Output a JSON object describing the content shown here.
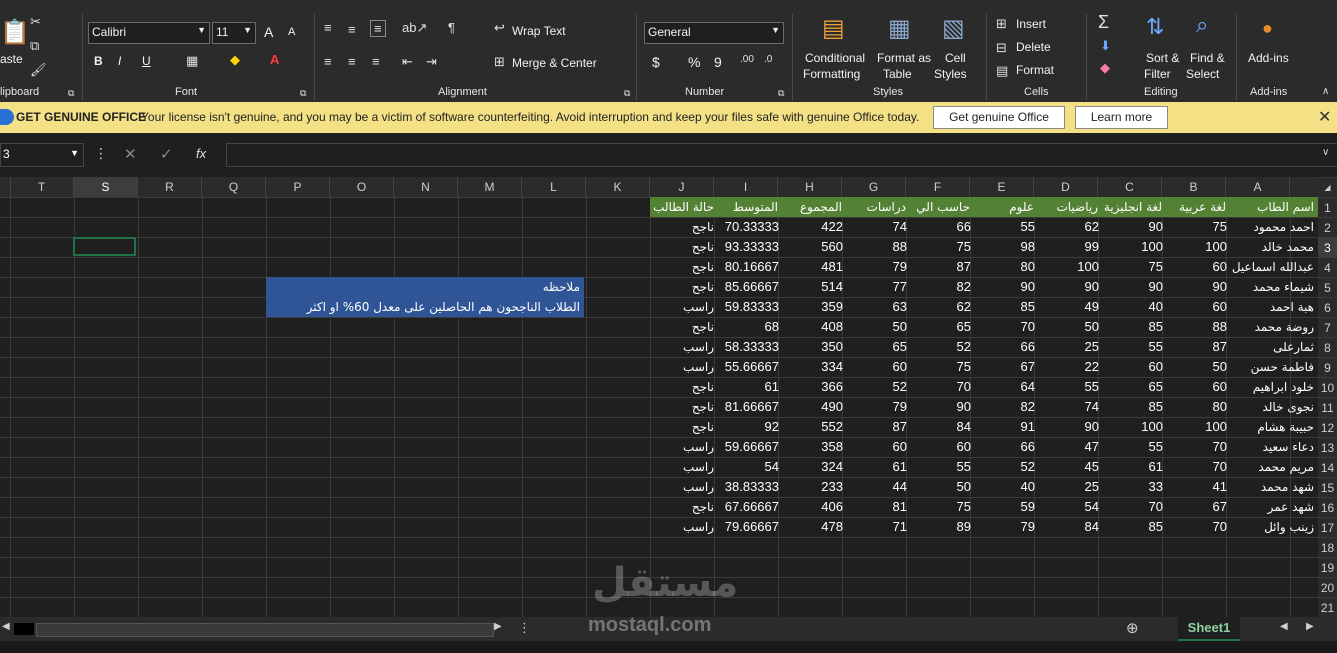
{
  "ribbon": {
    "clipboard": {
      "paste": "aste",
      "label": "lipboard"
    },
    "font": {
      "name": "Calibri",
      "size": "11",
      "label": "Font",
      "bold": "B",
      "italic": "I",
      "underline": "U",
      "grow": "A",
      "shrink": "A"
    },
    "alignment": {
      "wrap": "Wrap Text",
      "merge": "Merge & Center",
      "label": "Alignment"
    },
    "number": {
      "format": "General",
      "label": "Number",
      "currency": "$",
      "percent": "%",
      "comma": "9"
    },
    "styles": {
      "conditional": [
        "Conditional",
        "Formatting"
      ],
      "format_table": [
        "Format as",
        "Table"
      ],
      "cell_styles": [
        "Cell",
        "Styles"
      ],
      "label": "Styles"
    },
    "cells": {
      "insert": "Insert",
      "delete": "Delete",
      "format": "Format",
      "label": "Cells"
    },
    "editing": {
      "sort": [
        "Sort &",
        "Filter"
      ],
      "find": [
        "Find &",
        "Select"
      ],
      "label": "Editing"
    },
    "addins": {
      "button": "Add-ins",
      "label": "Add-ins"
    }
  },
  "banner": {
    "title": "GET GENUINE OFFICE",
    "message": "Your license isn't genuine, and you may be a victim of software counterfeiting. Avoid interruption and keep your files safe with genuine Office today.",
    "btn_genuine": "Get genuine Office",
    "btn_learn": "Learn more"
  },
  "formula_bar": {
    "namebox": "3",
    "fx": "fx",
    "value": ""
  },
  "columns": [
    "T",
    "S",
    "R",
    "Q",
    "P",
    "O",
    "N",
    "M",
    "L",
    "K",
    "J",
    "I",
    "H",
    "G",
    "F",
    "E",
    "D",
    "C",
    "B",
    "A"
  ],
  "rows": [
    "1",
    "2",
    "3",
    "4",
    "5",
    "6",
    "7",
    "8",
    "9",
    "10",
    "11",
    "12",
    "13",
    "14",
    "15",
    "16",
    "17",
    "18",
    "19",
    "20",
    "21"
  ],
  "table": {
    "headers": [
      "اسم الطاب",
      "لغة عربية",
      "لغة انجليزية",
      "رياضيات",
      "علوم",
      "حاسب الي",
      "دراسات",
      "المجموع",
      "المتوسط",
      "حالة الطالب"
    ],
    "rows": [
      [
        "احمد محمود",
        "75",
        "90",
        "62",
        "55",
        "66",
        "74",
        "422",
        "70.33333",
        "ناجح"
      ],
      [
        "محمد خالد",
        "100",
        "100",
        "99",
        "98",
        "75",
        "88",
        "560",
        "93.33333",
        "ناجح"
      ],
      [
        "عبدالله اسماعيل",
        "60",
        "75",
        "100",
        "80",
        "87",
        "79",
        "481",
        "80.16667",
        "ناجح"
      ],
      [
        "شيماء محمد",
        "90",
        "90",
        "90",
        "90",
        "82",
        "77",
        "514",
        "85.66667",
        "ناجح"
      ],
      [
        "هبة احمد",
        "60",
        "40",
        "49",
        "85",
        "62",
        "63",
        "359",
        "59.83333",
        "راسب"
      ],
      [
        "روضة محمد",
        "88",
        "85",
        "50",
        "70",
        "65",
        "50",
        "408",
        "68",
        "ناجح"
      ],
      [
        "ثمارعلى",
        "87",
        "55",
        "25",
        "66",
        "52",
        "65",
        "350",
        "58.33333",
        "راسب"
      ],
      [
        "فاطمة حسن",
        "50",
        "60",
        "22",
        "67",
        "75",
        "60",
        "334",
        "55.66667",
        "راسب"
      ],
      [
        "خلود ابراهيم",
        "60",
        "65",
        "55",
        "64",
        "70",
        "52",
        "366",
        "61",
        "ناجح"
      ],
      [
        "نجوى خالد",
        "80",
        "85",
        "74",
        "82",
        "90",
        "79",
        "490",
        "81.66667",
        "ناجح"
      ],
      [
        "حبيبة هشام",
        "100",
        "100",
        "90",
        "91",
        "84",
        "87",
        "552",
        "92",
        "ناجح"
      ],
      [
        "دعاء سعيد",
        "70",
        "55",
        "47",
        "66",
        "60",
        "60",
        "358",
        "59.66667",
        "راسب"
      ],
      [
        "مريم محمد",
        "70",
        "61",
        "45",
        "52",
        "55",
        "61",
        "324",
        "54",
        "راسب"
      ],
      [
        "شهد محمد",
        "41",
        "33",
        "25",
        "40",
        "50",
        "44",
        "233",
        "38.83333",
        "راسب"
      ],
      [
        "شهد عمر",
        "67",
        "70",
        "54",
        "59",
        "75",
        "81",
        "406",
        "67.66667",
        "ناجح"
      ],
      [
        "زينب وائل",
        "70",
        "85",
        "84",
        "79",
        "89",
        "71",
        "478",
        "79.66667",
        "راسب"
      ]
    ]
  },
  "note": {
    "title": "ملاحظه",
    "text": "الطلاب الناجحون هم الحاصلين على معدل 60% او اكثر"
  },
  "sheet_tab": "Sheet1",
  "watermark": {
    "text": "mostaql.com",
    "logo": "مستقل"
  },
  "colors": {
    "header_green": "#548235",
    "note_blue": "#2f5597",
    "banner_yellow": "#f4e186",
    "tab_green": "#217346"
  }
}
